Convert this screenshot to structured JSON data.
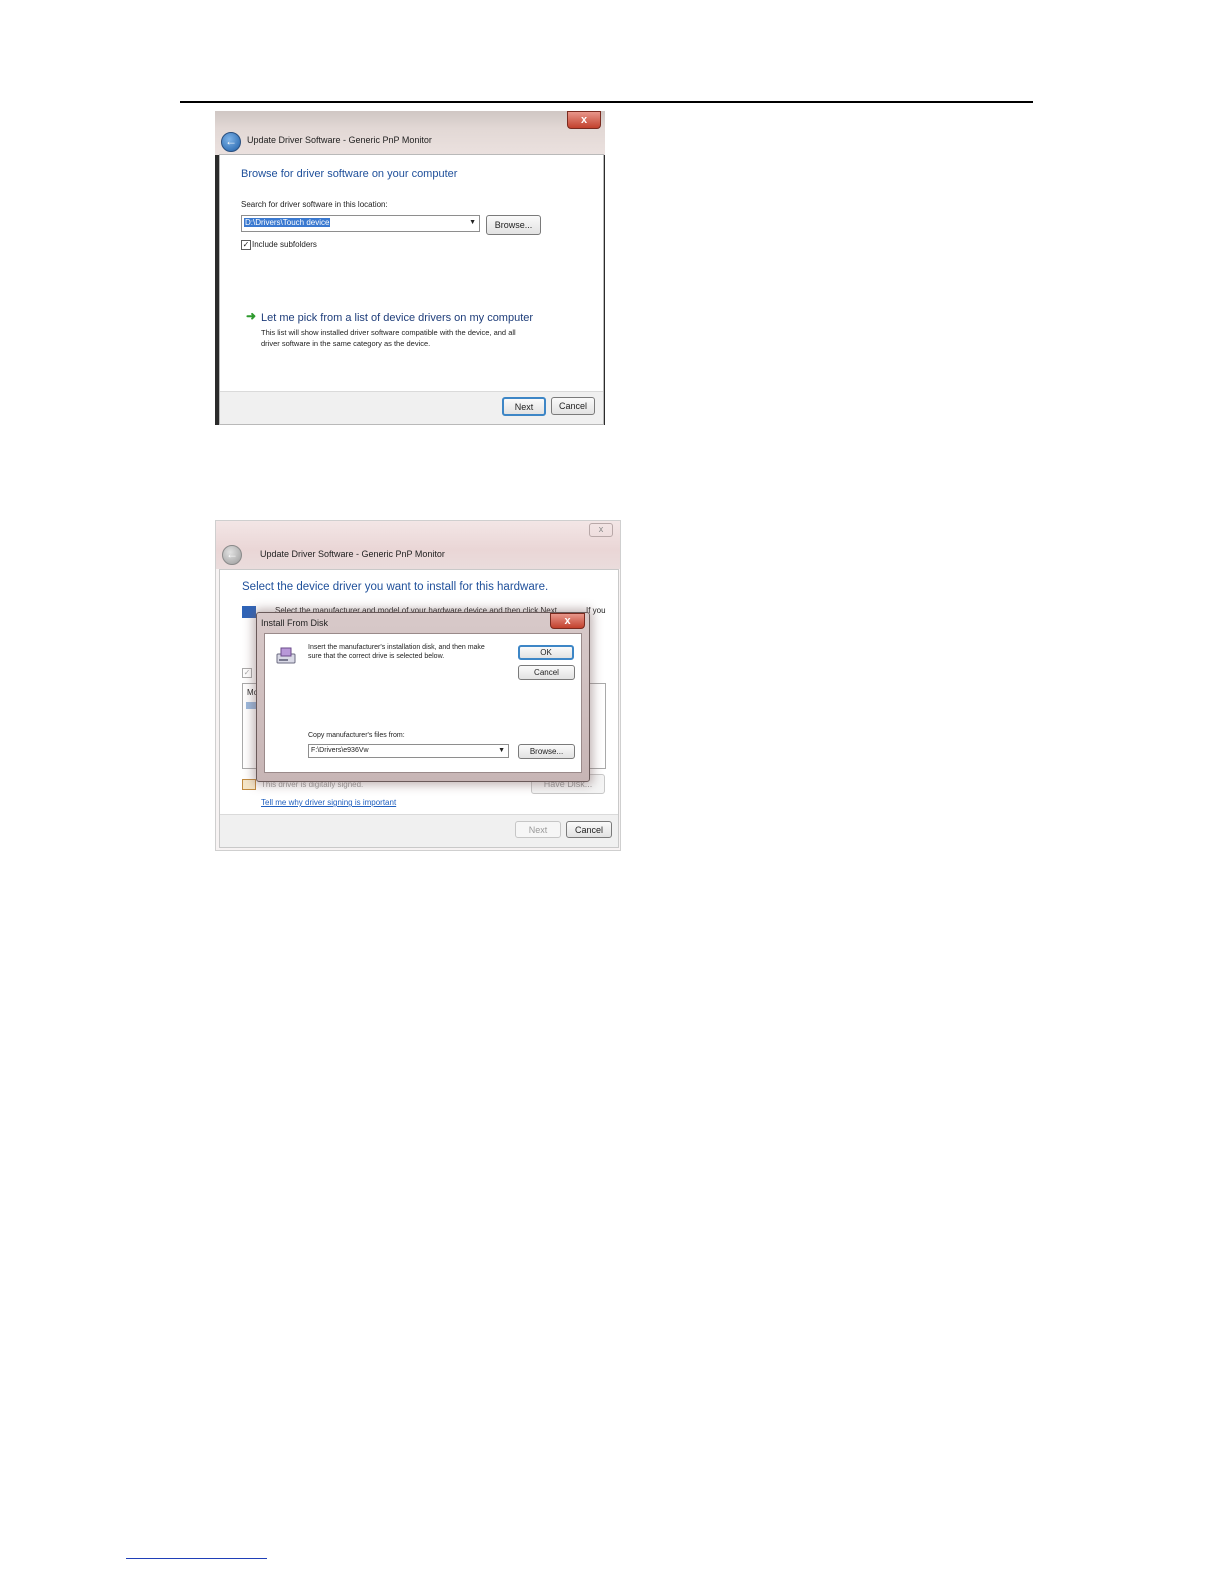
{
  "dialog1": {
    "window_title": "Update Driver Software - Generic PnP Monitor",
    "heading": "Browse for driver software on your computer",
    "search_label": "Search for driver software in this location:",
    "path_value": "D:\\Drivers\\Touch device",
    "browse_label": "Browse...",
    "include_subfolders_label": "Include subfolders",
    "pick_link": "Let me pick from a list of device drivers on my computer",
    "pick_description_line1": "This list will show installed driver software compatible with the device, and all",
    "pick_description_line2": "driver software in the same category as the device.",
    "next_label": "Next",
    "cancel_label": "Cancel",
    "close_glyph": "x"
  },
  "dialog2": {
    "window_title": "Update Driver Software - Generic PnP Monitor",
    "heading": "Select the device driver you want to install for this hardware.",
    "instruction_fragment_start": "Select the manufacturer and model of your hardware device and then click Next",
    "instruction_fragment_end": "If you",
    "list_header_fragment": "Mc",
    "signed_text": "This driver is digitally signed.",
    "signing_link": "Tell me why driver signing is important",
    "have_disk_label": "Have Disk...",
    "next_label": "Next",
    "cancel_label": "Cancel",
    "close_glyph": "x"
  },
  "install_from_disk": {
    "title": "Install From Disk",
    "message_line1": "Insert the manufacturer's installation disk, and then make",
    "message_line2": "sure that the correct drive is selected below.",
    "ok_label": "OK",
    "cancel_label": "Cancel",
    "copy_label": "Copy manufacturer's files from:",
    "path_value": "F:\\Drivers\\e936Vw",
    "browse_label": "Browse...",
    "close_glyph": "x"
  }
}
